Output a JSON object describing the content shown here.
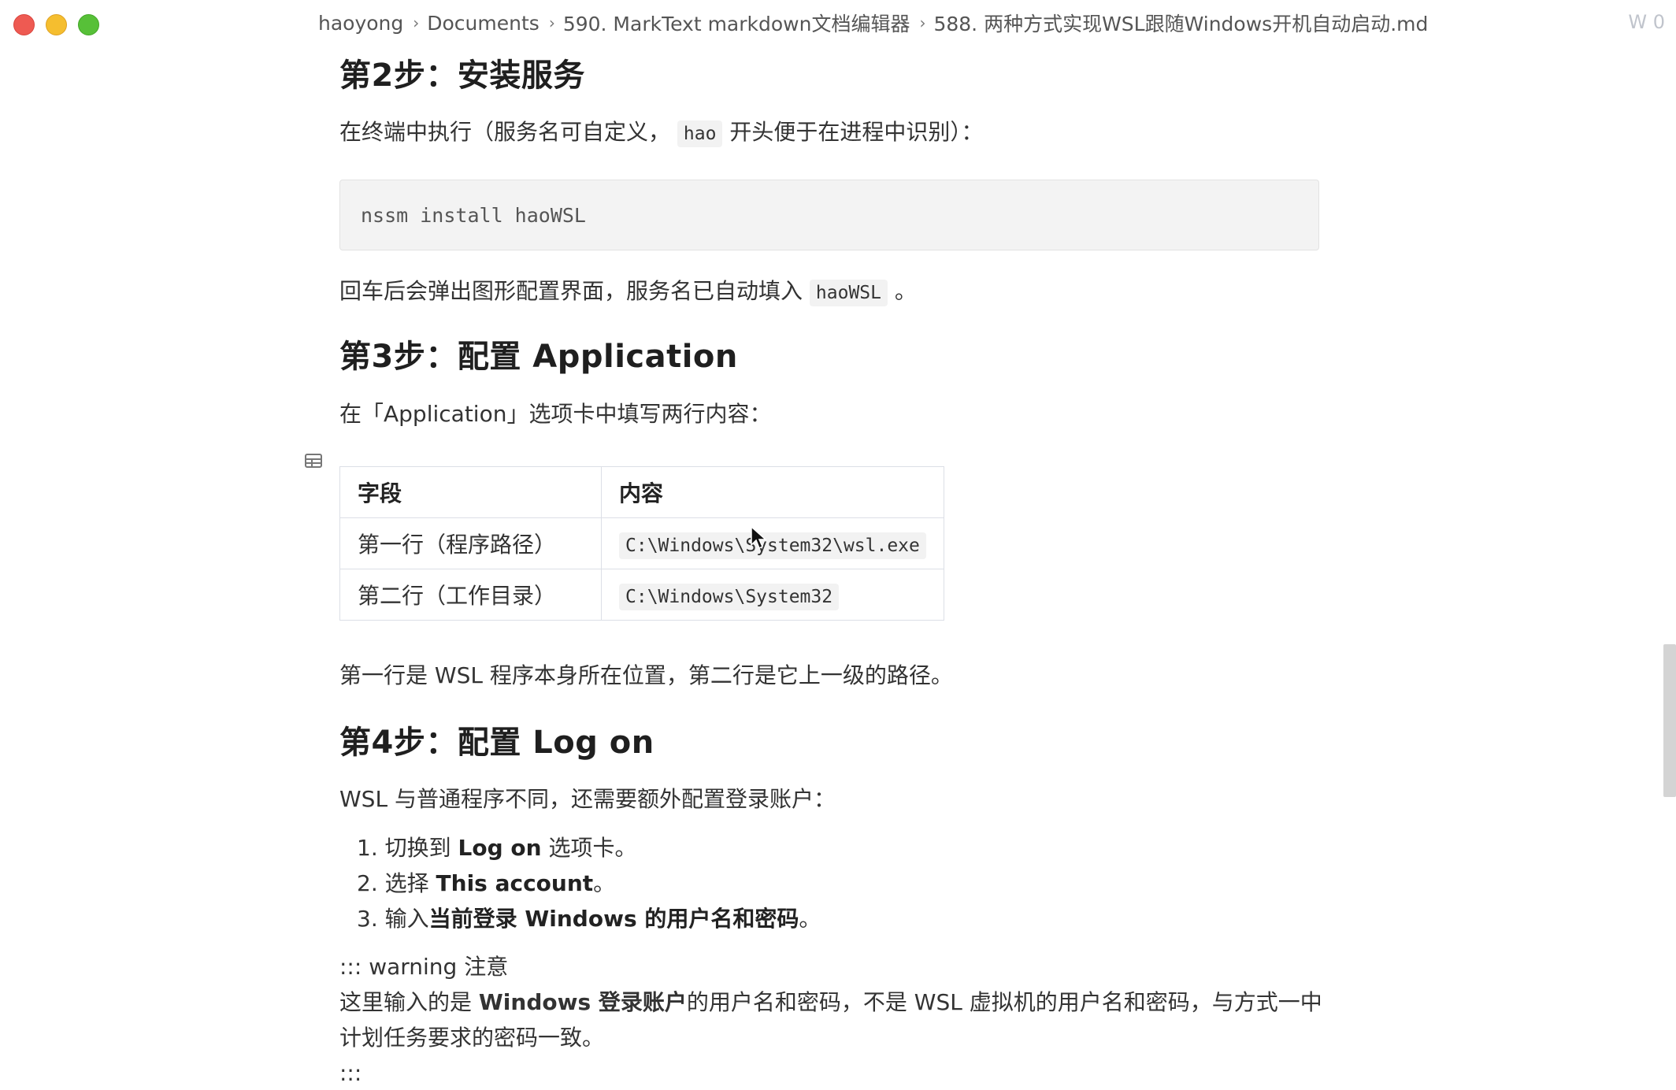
{
  "breadcrumb": [
    "haoyong",
    "Documents",
    "590. MarkText markdown文档编辑器",
    "588. 两种方式实现WSL跟随Windows开机自动启动.md"
  ],
  "word_count": "W 0",
  "doc": {
    "step2_heading": "第2步：安装服务",
    "step2_intro_before": "在终端中执行（服务名可自定义，",
    "step2_intro_code": "hao",
    "step2_intro_after": "开头便于在进程中识别）：",
    "install_command": "nssm install haoWSL",
    "step2_after_before": "回车后会弹出图形配置界面，服务名已自动填入",
    "step2_after_code": "haoWSL",
    "step2_after_end": "。",
    "step3_heading": "第3步：配置 Application",
    "step3_intro": "在「Application」选项卡中填写两行内容：",
    "table": {
      "headers": [
        "字段",
        "内容"
      ],
      "rows": [
        [
          "第一行（程序路径）",
          "C:\\Windows\\System32\\wsl.exe"
        ],
        [
          "第二行（工作目录）",
          "C:\\Windows\\System32"
        ]
      ]
    },
    "step3_note": "第一行是 WSL 程序本身所在位置，第二行是它上一级的路径。",
    "step4_heading": "第4步：配置 Log on",
    "step4_intro": "WSL 与普通程序不同，还需要额外配置登录账户：",
    "steps": [
      {
        "num": "1.",
        "before": "切换到 ",
        "bold": "Log on",
        "after": " 选项卡。"
      },
      {
        "num": "2.",
        "before": "选择 ",
        "bold": "This account",
        "after": "。"
      },
      {
        "num": "3.",
        "before": "输入",
        "bold": "当前登录 Windows 的用户名和密码",
        "after": "。"
      }
    ],
    "warning_open": "::: warning 注意",
    "warning_before": "这里输入的是 ",
    "warning_bold": "Windows 登录账户",
    "warning_after": "的用户名和密码，不是 WSL 虚拟机的用户名和密码，与方式一中",
    "warning_line2": "计划任务要求的密码一致。",
    "warning_close": ":::"
  }
}
